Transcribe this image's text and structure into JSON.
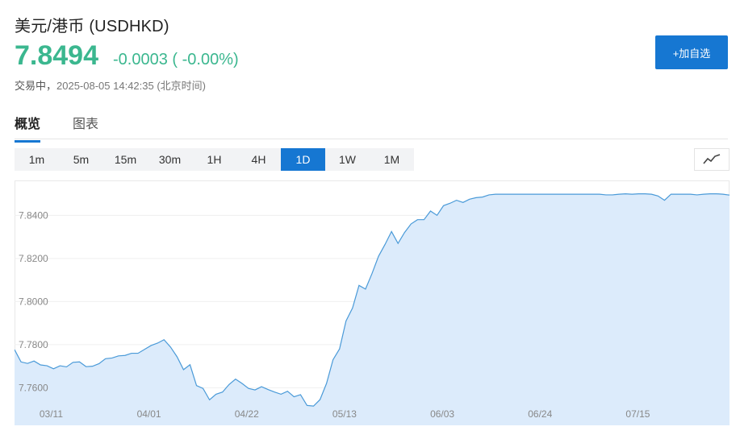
{
  "header": {
    "title": "美元/港币  (USDHKD)",
    "price": "7.8494",
    "change": "-0.0003 ( -0.00%)",
    "status_label": "交易中，",
    "timestamp": "2025-08-05 14:42:35 (北京时间)",
    "add_button": "+加自选"
  },
  "colors": {
    "price_color": "#3bb78f",
    "accent": "#1677d2",
    "line": "#4a9ad8",
    "fill": "#dcebfb"
  },
  "tabs": [
    {
      "label": "概览",
      "active": true
    },
    {
      "label": "图表",
      "active": false
    }
  ],
  "periods": [
    {
      "label": "1m",
      "active": false
    },
    {
      "label": "5m",
      "active": false
    },
    {
      "label": "15m",
      "active": false
    },
    {
      "label": "30m",
      "active": false
    },
    {
      "label": "1H",
      "active": false
    },
    {
      "label": "4H",
      "active": false
    },
    {
      "label": "1D",
      "active": true
    },
    {
      "label": "1W",
      "active": false
    },
    {
      "label": "1M",
      "active": false
    }
  ],
  "chart_type_icon": "line-chart-icon",
  "chart_data": {
    "type": "area",
    "y_ticks": [
      "7.8400",
      "7.8200",
      "7.8000",
      "7.7800",
      "7.7600"
    ],
    "y_tick_values": [
      7.84,
      7.82,
      7.8,
      7.78,
      7.76
    ],
    "x_ticks": [
      "03/11",
      "04/01",
      "04/22",
      "05/13",
      "06/03",
      "06/24",
      "07/15"
    ],
    "x_tick_positions": [
      6,
      22,
      38,
      54,
      70,
      86,
      102
    ],
    "ylim": [
      7.7508,
      7.8562
    ],
    "xlim": [
      0,
      117
    ],
    "grid": true,
    "values": [
      7.7777,
      7.772,
      7.7713,
      7.7724,
      7.7706,
      7.7702,
      7.7688,
      7.7702,
      7.7697,
      7.7718,
      7.772,
      7.7698,
      7.77,
      7.7712,
      7.7735,
      7.7738,
      7.7748,
      7.775,
      7.776,
      7.776,
      7.7778,
      7.7796,
      7.7807,
      7.7823,
      7.7789,
      7.7744,
      7.7684,
      7.7707,
      7.761,
      7.7597,
      7.7544,
      7.757,
      7.758,
      7.7615,
      7.764,
      7.762,
      7.7597,
      7.759,
      7.7605,
      7.7592,
      7.758,
      7.757,
      7.7584,
      7.7558,
      7.7568,
      7.7518,
      7.7515,
      7.7545,
      7.762,
      7.773,
      7.778,
      7.791,
      7.797,
      7.8075,
      7.8058,
      7.813,
      7.821,
      7.8265,
      7.8325,
      7.827,
      7.832,
      7.836,
      7.838,
      7.838,
      7.842,
      7.84,
      7.8445,
      7.8456,
      7.847,
      7.846,
      7.8475,
      7.8482,
      7.8485,
      7.8495,
      7.8498,
      7.8498,
      7.8498,
      7.8498,
      7.8498,
      7.8498,
      7.8498,
      7.8498,
      7.8498,
      7.8498,
      7.8498,
      7.8498,
      7.8498,
      7.8498,
      7.8498,
      7.8498,
      7.8498,
      7.8495,
      7.8495,
      7.8498,
      7.85,
      7.8498,
      7.85,
      7.85,
      7.8498,
      7.849,
      7.847,
      7.8498,
      7.8498,
      7.8498,
      7.8498,
      7.8495,
      7.8498,
      7.85,
      7.85,
      7.8498,
      7.8494
    ]
  }
}
